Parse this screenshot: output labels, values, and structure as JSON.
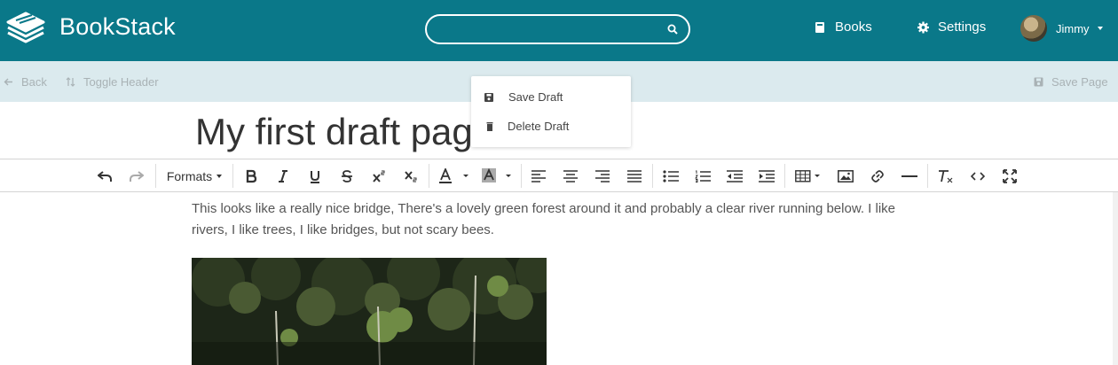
{
  "header": {
    "brand": "BookStack",
    "search_placeholder": "",
    "nav": {
      "books": "Books",
      "settings": "Settings"
    },
    "user": {
      "name": "Jimmy"
    }
  },
  "toolbar": {
    "back": "Back",
    "toggle_header": "Toggle Header",
    "save_page": "Save Page"
  },
  "draft_menu": {
    "save_draft": "Save Draft",
    "delete_draft": "Delete Draft"
  },
  "page": {
    "title": "My first draft page",
    "body_text": "This looks like a really nice bridge, There's a lovely green forest around it and probably a clear river running below. I like rivers, I like trees, I like bridges, but not scary bees."
  },
  "editor": {
    "formats_label": "Formats"
  },
  "colors": {
    "header_bg": "#0a7889",
    "toolbar_bg": "#dbeaee"
  }
}
